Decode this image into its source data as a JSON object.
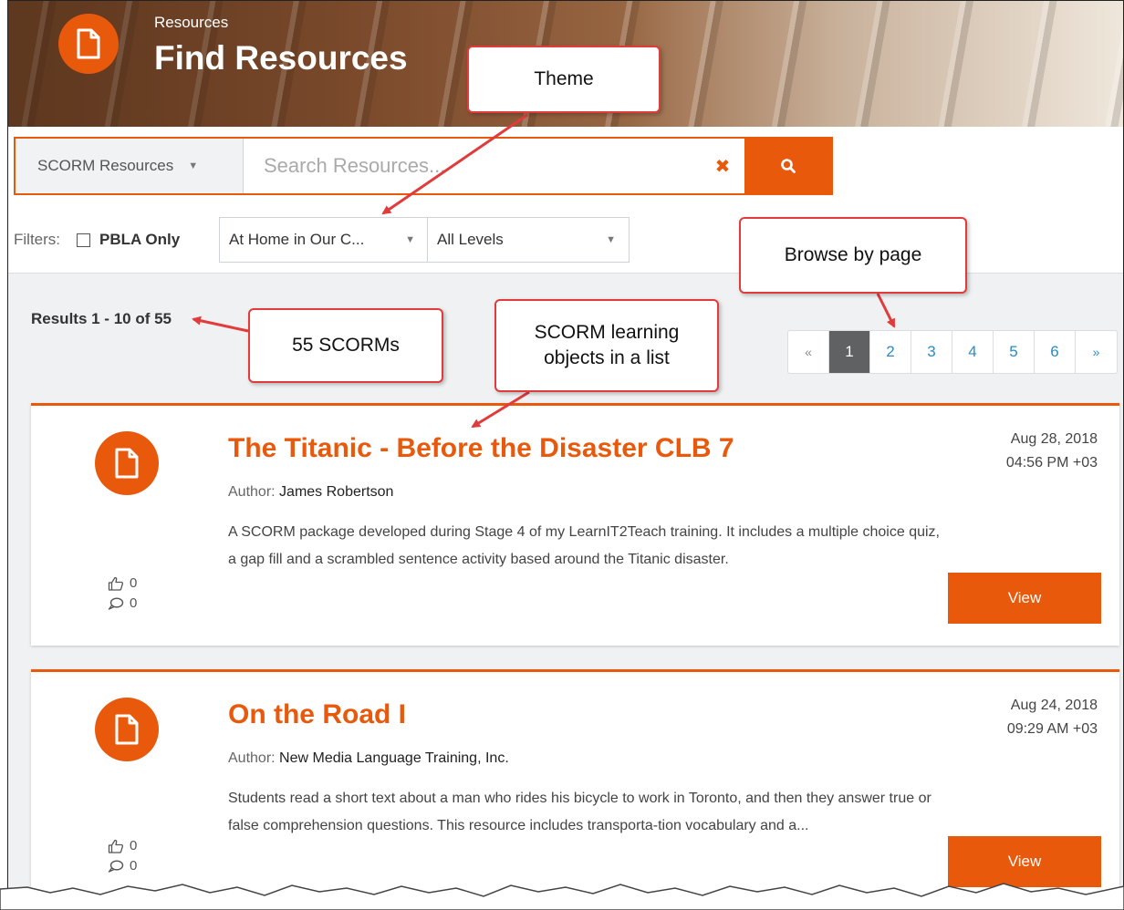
{
  "header": {
    "breadcrumb": "Resources",
    "title": "Find Resources"
  },
  "search": {
    "type_label": "SCORM Resources",
    "placeholder": "Search Resources...",
    "clear_glyph": "✖"
  },
  "filters": {
    "label": "Filters:",
    "pbla_label": "PBLA Only",
    "theme_value": "At Home in Our C...",
    "level_value": "All Levels"
  },
  "results": {
    "summary": "Results 1 - 10 of 55"
  },
  "pagination": {
    "prev": "«",
    "pages": [
      "1",
      "2",
      "3",
      "4",
      "5",
      "6"
    ],
    "next": "»",
    "active": "1"
  },
  "resources": [
    {
      "title": "The Titanic - Before the Disaster CLB 7",
      "author_label": "Author:",
      "author": "James Robertson",
      "description": "A SCORM package developed during Stage 4 of my LearnIT2Teach training. It includes a multiple choice quiz, a gap fill and a scrambled sentence activity based around the Titanic disaster.",
      "date": "Aug 28, 2018",
      "time": "04:56 PM +03",
      "likes": "0",
      "comments": "0",
      "view_label": "View"
    },
    {
      "title": "On the Road I",
      "author_label": "Author:",
      "author": "New Media Language Training, Inc.",
      "description": "Students read a short text about a man who rides his bicycle to work in Toronto, and then they answer true or false comprehension questions. This resource includes transporta-tion vocabulary and a...",
      "date": "Aug 24, 2018",
      "time": "09:29 AM +03",
      "likes": "0",
      "comments": "0",
      "view_label": "View"
    }
  ],
  "callouts": {
    "theme": "Theme",
    "browse": "Browse by page",
    "count": "55 SCORMs",
    "list_line1": "SCORM learning",
    "list_line2": "objects in a list"
  },
  "colors": {
    "accent": "#e8590c",
    "callout_border": "#e23b3b",
    "active_page": "#5f6163",
    "link": "#2a8cc7"
  },
  "icons": {
    "logo": "document-icon",
    "search": "search-icon",
    "like": "thumbs-up-icon",
    "comment": "comment-icon"
  }
}
